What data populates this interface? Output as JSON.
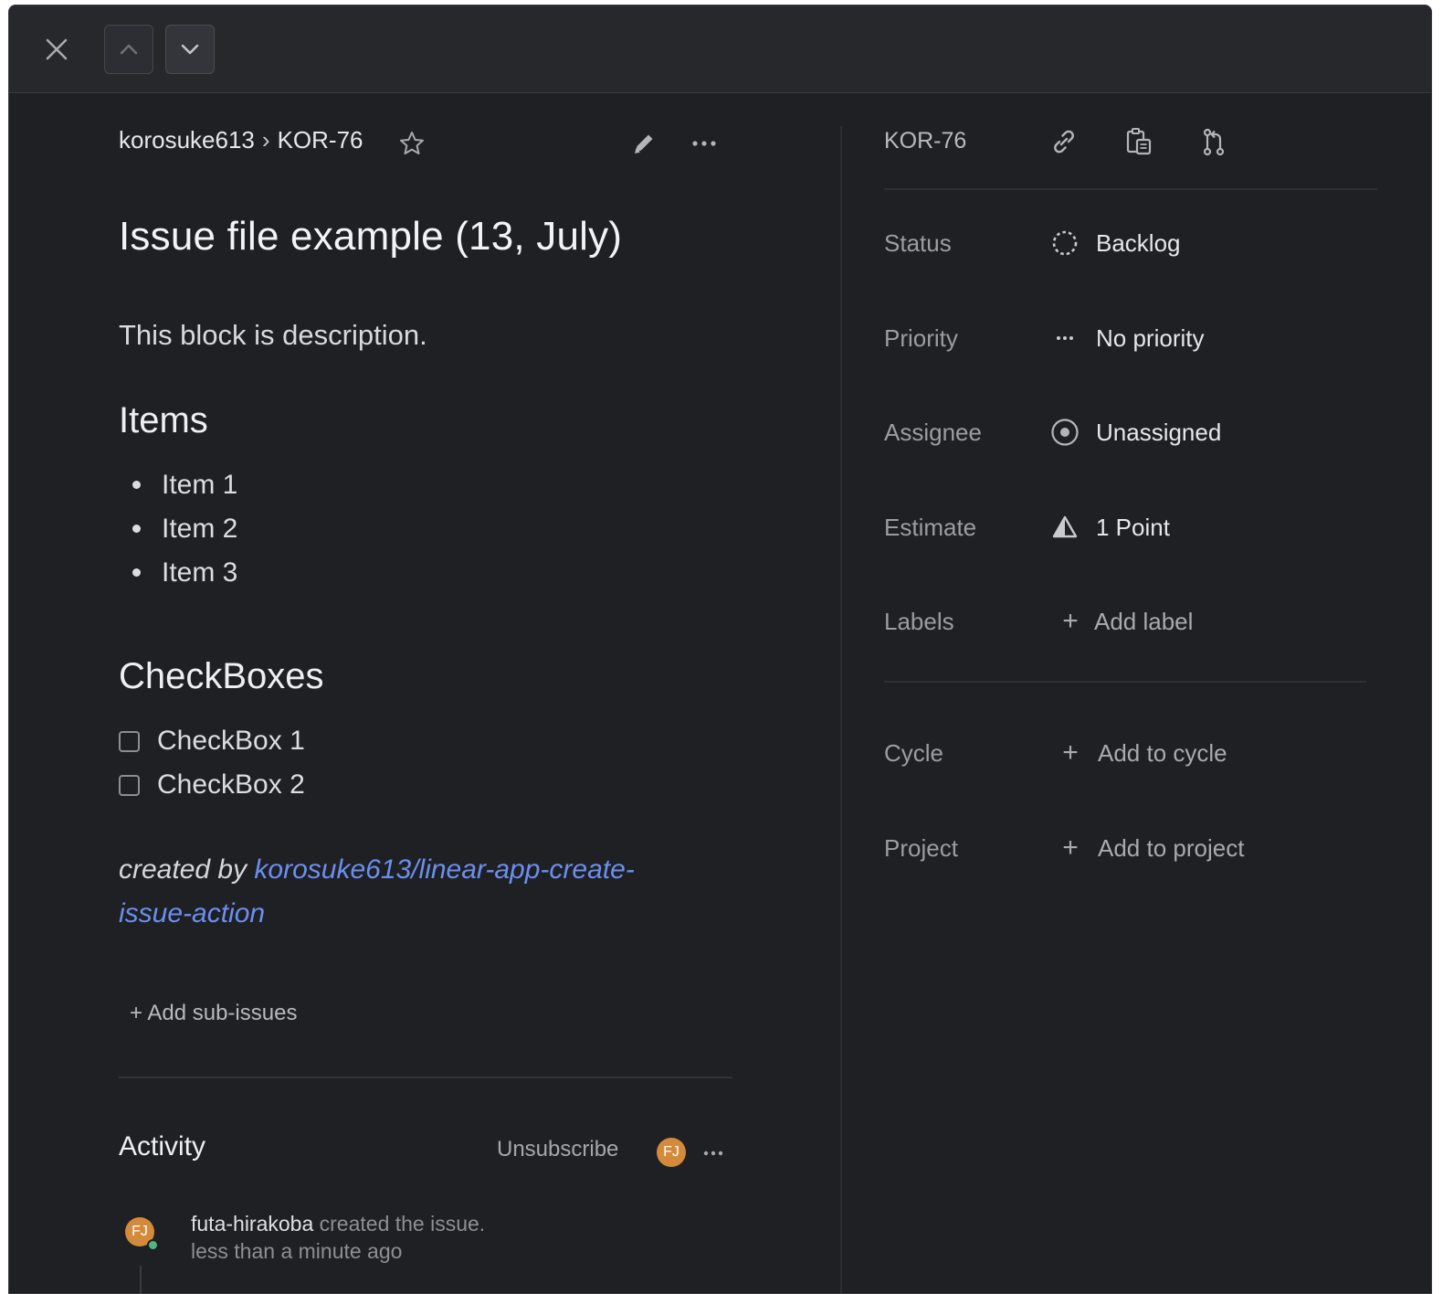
{
  "topbar": {
    "close_icon": "close-icon",
    "prev_icon": "chevron-up-icon",
    "next_icon": "chevron-down-icon"
  },
  "issue": {
    "team": "korosuke613",
    "separator": "›",
    "id": "KOR-76",
    "title": "Issue file example (13, July)",
    "description": "This block is description.",
    "items_heading": "Items",
    "items": [
      "Item 1",
      "Item 2",
      "Item 3"
    ],
    "checkboxes_heading": "CheckBoxes",
    "checkboxes": [
      {
        "label": "CheckBox 1",
        "checked": false
      },
      {
        "label": "CheckBox 2",
        "checked": false
      }
    ],
    "created_by_prefix": "created by ",
    "created_by_link": "korosuke613/linear-app-create-issue-action",
    "add_sub_issues": "+ Add sub-issues"
  },
  "activity": {
    "title": "Activity",
    "unsubscribe": "Unsubscribe",
    "subscriber_initials": "FJ",
    "entries": [
      {
        "initials": "FJ",
        "user": "futa-hirakoba",
        "action": " created the issue.",
        "time": "less than a minute ago"
      }
    ]
  },
  "sidebar": {
    "id": "KOR-76",
    "icons": [
      "link-icon",
      "copy-icon",
      "git-branch-icon"
    ],
    "properties": [
      {
        "label": "Status",
        "value": "Backlog",
        "icon": "backlog-status-icon"
      },
      {
        "label": "Priority",
        "value": "No priority",
        "icon": "no-priority-icon"
      },
      {
        "label": "Assignee",
        "value": "Unassigned",
        "icon": "unassigned-avatar-icon"
      },
      {
        "label": "Estimate",
        "value": "1 Point",
        "icon": "estimate-triangle-icon"
      },
      {
        "label": "Labels",
        "value": "Add label",
        "icon": "plus-icon"
      }
    ],
    "extra_properties": [
      {
        "label": "Cycle",
        "value": "Add to cycle",
        "icon": "plus-icon"
      },
      {
        "label": "Project",
        "value": "Add to project",
        "icon": "plus-icon"
      }
    ]
  },
  "colors": {
    "background": "#1f2023",
    "topbar": "#27282c",
    "link": "#6b8ff0",
    "avatar": "#d48a3b",
    "online": "#4cb782"
  }
}
